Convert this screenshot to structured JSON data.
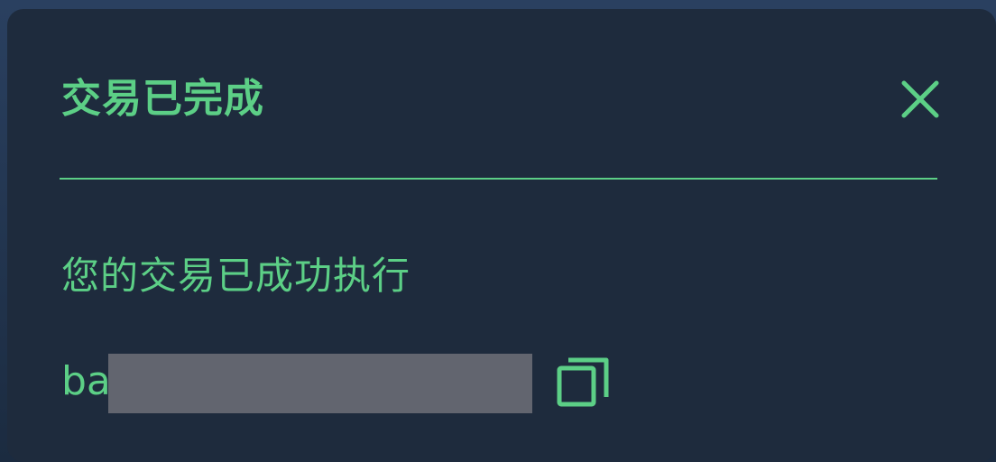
{
  "toast": {
    "title": "交易已完成",
    "message": "您的交易已成功执行",
    "tx_hash_visible_prefix": "ba",
    "close_icon": "close-icon",
    "copy_icon": "copy-icon"
  },
  "colors": {
    "accent": "#5ccf86",
    "panel_bg": "#1e2b3d",
    "redaction": "#62656f"
  }
}
